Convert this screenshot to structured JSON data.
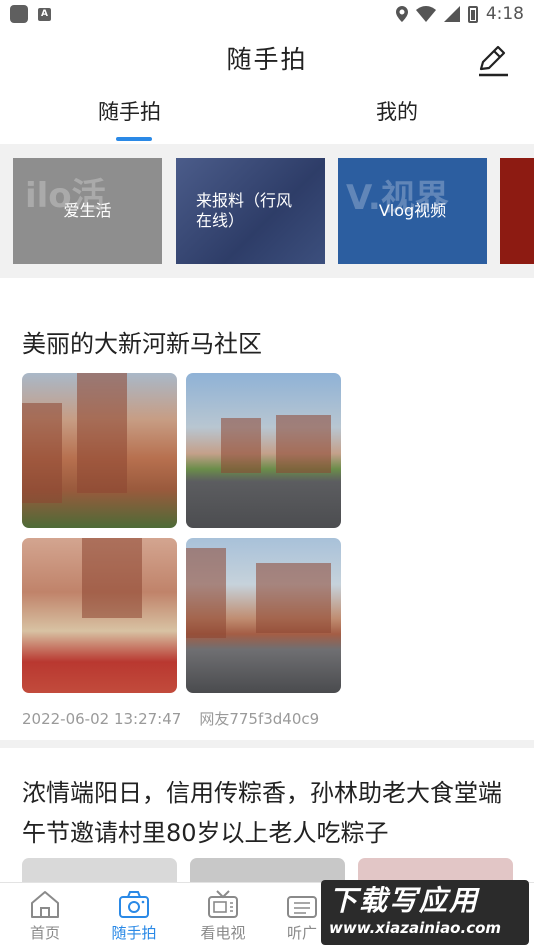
{
  "status_bar": {
    "time": "4:18",
    "notification_badge": "A"
  },
  "header": {
    "title": "随手拍"
  },
  "tabs": [
    {
      "label": "随手拍",
      "active": true
    },
    {
      "label": "我的",
      "active": false
    }
  ],
  "banners": [
    {
      "label": "爱生活",
      "logo_text": "ilo活"
    },
    {
      "label": "来报料（行风在线）"
    },
    {
      "label": "Vlog视频",
      "logo_text": "V.视界"
    },
    {
      "label": ""
    }
  ],
  "posts": [
    {
      "title": "美丽的大新河新马社区",
      "timestamp": "2022-06-02 13:27:47",
      "author": "网友775f3d40c9",
      "photo_count": 4
    },
    {
      "title": "浓情端阳日，信用传粽香，孙林助老大食堂端午节邀请村里80岁以上老人吃粽子"
    }
  ],
  "bottom_nav": [
    {
      "label": "首页",
      "icon": "home-icon",
      "active": false
    },
    {
      "label": "随手拍",
      "icon": "camera-icon",
      "active": true
    },
    {
      "label": "看电视",
      "icon": "tv-icon",
      "active": false
    },
    {
      "label": "听广",
      "icon": "radio-icon",
      "active": false
    }
  ],
  "watermark": {
    "main": "下载写应用",
    "url": "www.xiazainiao.com"
  },
  "colors": {
    "accent": "#2a89e6",
    "meta_text": "#9a9a9a",
    "divider": "#f1f1f1"
  }
}
